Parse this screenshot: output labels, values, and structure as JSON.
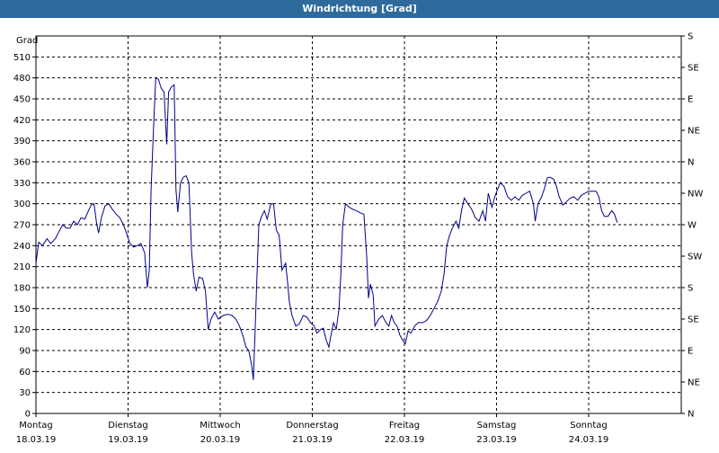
{
  "window": {
    "title": "Windrichtung [Grad]"
  },
  "chart_data": {
    "type": "line",
    "title": "Windrichtung [Grad]",
    "ylabel": "Grad",
    "ylim": [
      0,
      540
    ],
    "grid": true,
    "y_ticks": [
      0,
      30,
      60,
      90,
      120,
      150,
      180,
      210,
      240,
      270,
      300,
      330,
      360,
      390,
      420,
      450,
      480,
      510
    ],
    "right_axis_labels": [
      "N",
      "NE",
      "E",
      "SE",
      "S",
      "SW",
      "W",
      "NW",
      "N",
      "NE",
      "E",
      "SE",
      "S"
    ],
    "x_labels": [
      {
        "day": "Montag",
        "date": "18.03.19"
      },
      {
        "day": "Dienstag",
        "date": "19.03.19"
      },
      {
        "day": "Mittwoch",
        "date": "20.03.19"
      },
      {
        "day": "Donnerstag",
        "date": "21.03.19"
      },
      {
        "day": "Freitag",
        "date": "22.03.19"
      },
      {
        "day": "Samstag",
        "date": "23.03.19"
      },
      {
        "day": "Sonntag",
        "date": "24.03.19"
      }
    ],
    "line_color": "#00008b",
    "series": [
      {
        "points": [
          [
            0.0,
            215
          ],
          [
            0.03,
            245
          ],
          [
            0.07,
            240
          ],
          [
            0.12,
            250
          ],
          [
            0.16,
            243
          ],
          [
            0.21,
            250
          ],
          [
            0.25,
            260
          ],
          [
            0.29,
            270
          ],
          [
            0.33,
            265
          ],
          [
            0.37,
            265
          ],
          [
            0.41,
            275
          ],
          [
            0.45,
            270
          ],
          [
            0.49,
            280
          ],
          [
            0.53,
            278
          ],
          [
            0.57,
            290
          ],
          [
            0.6,
            298
          ],
          [
            0.63,
            300
          ],
          [
            0.66,
            270
          ],
          [
            0.68,
            258
          ],
          [
            0.71,
            280
          ],
          [
            0.75,
            297
          ],
          [
            0.79,
            300
          ],
          [
            0.83,
            292
          ],
          [
            0.87,
            285
          ],
          [
            0.91,
            280
          ],
          [
            0.95,
            270
          ],
          [
            0.99,
            255
          ],
          [
            1.02,
            243
          ],
          [
            1.06,
            238
          ],
          [
            1.1,
            240
          ],
          [
            1.14,
            243
          ],
          [
            1.18,
            230
          ],
          [
            1.21,
            180
          ],
          [
            1.23,
            205
          ],
          [
            1.25,
            320
          ],
          [
            1.28,
            420
          ],
          [
            1.3,
            480
          ],
          [
            1.33,
            478
          ],
          [
            1.36,
            465
          ],
          [
            1.39,
            460
          ],
          [
            1.42,
            385
          ],
          [
            1.44,
            460
          ],
          [
            1.47,
            467
          ],
          [
            1.5,
            470
          ],
          [
            1.52,
            320
          ],
          [
            1.54,
            288
          ],
          [
            1.57,
            330
          ],
          [
            1.6,
            338
          ],
          [
            1.63,
            340
          ],
          [
            1.66,
            330
          ],
          [
            1.69,
            230
          ],
          [
            1.71,
            200
          ],
          [
            1.74,
            175
          ],
          [
            1.77,
            195
          ],
          [
            1.81,
            193
          ],
          [
            1.84,
            175
          ],
          [
            1.87,
            120
          ],
          [
            1.9,
            135
          ],
          [
            1.94,
            145
          ],
          [
            1.98,
            135
          ],
          [
            2.03,
            140
          ],
          [
            2.08,
            142
          ],
          [
            2.13,
            140
          ],
          [
            2.17,
            135
          ],
          [
            2.21,
            125
          ],
          [
            2.25,
            110
          ],
          [
            2.28,
            95
          ],
          [
            2.31,
            90
          ],
          [
            2.34,
            70
          ],
          [
            2.36,
            48
          ],
          [
            2.38,
            120
          ],
          [
            2.4,
            200
          ],
          [
            2.42,
            270
          ],
          [
            2.45,
            282
          ],
          [
            2.48,
            290
          ],
          [
            2.51,
            278
          ],
          [
            2.55,
            300
          ],
          [
            2.58,
            300
          ],
          [
            2.61,
            262
          ],
          [
            2.64,
            255
          ],
          [
            2.67,
            205
          ],
          [
            2.71,
            215
          ],
          [
            2.73,
            190
          ],
          [
            2.75,
            160
          ],
          [
            2.78,
            140
          ],
          [
            2.82,
            125
          ],
          [
            2.86,
            128
          ],
          [
            2.9,
            140
          ],
          [
            2.94,
            138
          ],
          [
            2.98,
            130
          ],
          [
            3.02,
            125
          ],
          [
            3.05,
            115
          ],
          [
            3.09,
            120
          ],
          [
            3.12,
            122
          ],
          [
            3.15,
            105
          ],
          [
            3.18,
            95
          ],
          [
            3.2,
            110
          ],
          [
            3.23,
            130
          ],
          [
            3.26,
            120
          ],
          [
            3.29,
            150
          ],
          [
            3.31,
            200
          ],
          [
            3.33,
            270
          ],
          [
            3.36,
            300
          ],
          [
            3.4,
            295
          ],
          [
            3.44,
            292
          ],
          [
            3.48,
            290
          ],
          [
            3.52,
            287
          ],
          [
            3.56,
            285
          ],
          [
            3.59,
            225
          ],
          [
            3.61,
            165
          ],
          [
            3.63,
            185
          ],
          [
            3.66,
            170
          ],
          [
            3.68,
            125
          ],
          [
            3.72,
            135
          ],
          [
            3.76,
            140
          ],
          [
            3.8,
            130
          ],
          [
            3.83,
            125
          ],
          [
            3.86,
            140
          ],
          [
            3.89,
            130
          ],
          [
            3.92,
            125
          ],
          [
            3.95,
            112
          ],
          [
            3.98,
            105
          ],
          [
            4.01,
            100
          ],
          [
            4.04,
            118
          ],
          [
            4.07,
            115
          ],
          [
            4.11,
            125
          ],
          [
            4.15,
            130
          ],
          [
            4.2,
            130
          ],
          [
            4.24,
            133
          ],
          [
            4.28,
            140
          ],
          [
            4.32,
            150
          ],
          [
            4.36,
            160
          ],
          [
            4.4,
            175
          ],
          [
            4.43,
            200
          ],
          [
            4.46,
            240
          ],
          [
            4.49,
            255
          ],
          [
            4.52,
            265
          ],
          [
            4.56,
            275
          ],
          [
            4.59,
            265
          ],
          [
            4.62,
            290
          ],
          [
            4.65,
            308
          ],
          [
            4.69,
            300
          ],
          [
            4.73,
            292
          ],
          [
            4.77,
            280
          ],
          [
            4.81,
            275
          ],
          [
            4.85,
            290
          ],
          [
            4.88,
            275
          ],
          [
            4.91,
            315
          ],
          [
            4.95,
            295
          ],
          [
            4.98,
            310
          ],
          [
            5.01,
            320
          ],
          [
            5.04,
            330
          ],
          [
            5.08,
            325
          ],
          [
            5.12,
            310
          ],
          [
            5.16,
            305
          ],
          [
            5.2,
            310
          ],
          [
            5.24,
            305
          ],
          [
            5.28,
            312
          ],
          [
            5.32,
            315
          ],
          [
            5.36,
            318
          ],
          [
            5.4,
            300
          ],
          [
            5.42,
            275
          ],
          [
            5.45,
            300
          ],
          [
            5.49,
            310
          ],
          [
            5.52,
            322
          ],
          [
            5.55,
            337
          ],
          [
            5.58,
            338
          ],
          [
            5.62,
            335
          ],
          [
            5.65,
            325
          ],
          [
            5.68,
            310
          ],
          [
            5.72,
            298
          ],
          [
            5.76,
            303
          ],
          [
            5.8,
            308
          ],
          [
            5.84,
            310
          ],
          [
            5.88,
            305
          ],
          [
            5.92,
            312
          ],
          [
            5.96,
            315
          ],
          [
            6.0,
            318
          ],
          [
            6.04,
            318
          ],
          [
            6.08,
            318
          ],
          [
            6.11,
            310
          ],
          [
            6.14,
            290
          ],
          [
            6.17,
            282
          ],
          [
            6.21,
            282
          ],
          [
            6.25,
            290
          ],
          [
            6.28,
            285
          ],
          [
            6.31,
            273
          ]
        ]
      }
    ]
  }
}
